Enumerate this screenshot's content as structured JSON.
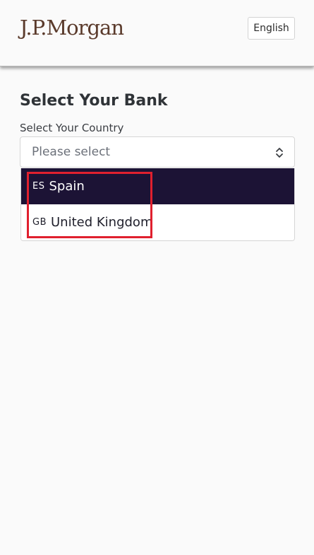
{
  "header": {
    "logo": "J.P.Morgan",
    "language_button": "English"
  },
  "main": {
    "title": "Select Your Bank",
    "country_label": "Select Your Country",
    "country_select": {
      "placeholder": "Please select",
      "options": [
        {
          "code": "ES",
          "name": "Spain",
          "active": true
        },
        {
          "code": "GB",
          "name": "United Kingdom",
          "active": false
        }
      ]
    }
  },
  "colors": {
    "brand": "#5a3a2b",
    "option_active_bg": "#1c1335",
    "highlight_box": "#e0202e"
  },
  "icons": [
    "chevron-up-down-icon"
  ]
}
